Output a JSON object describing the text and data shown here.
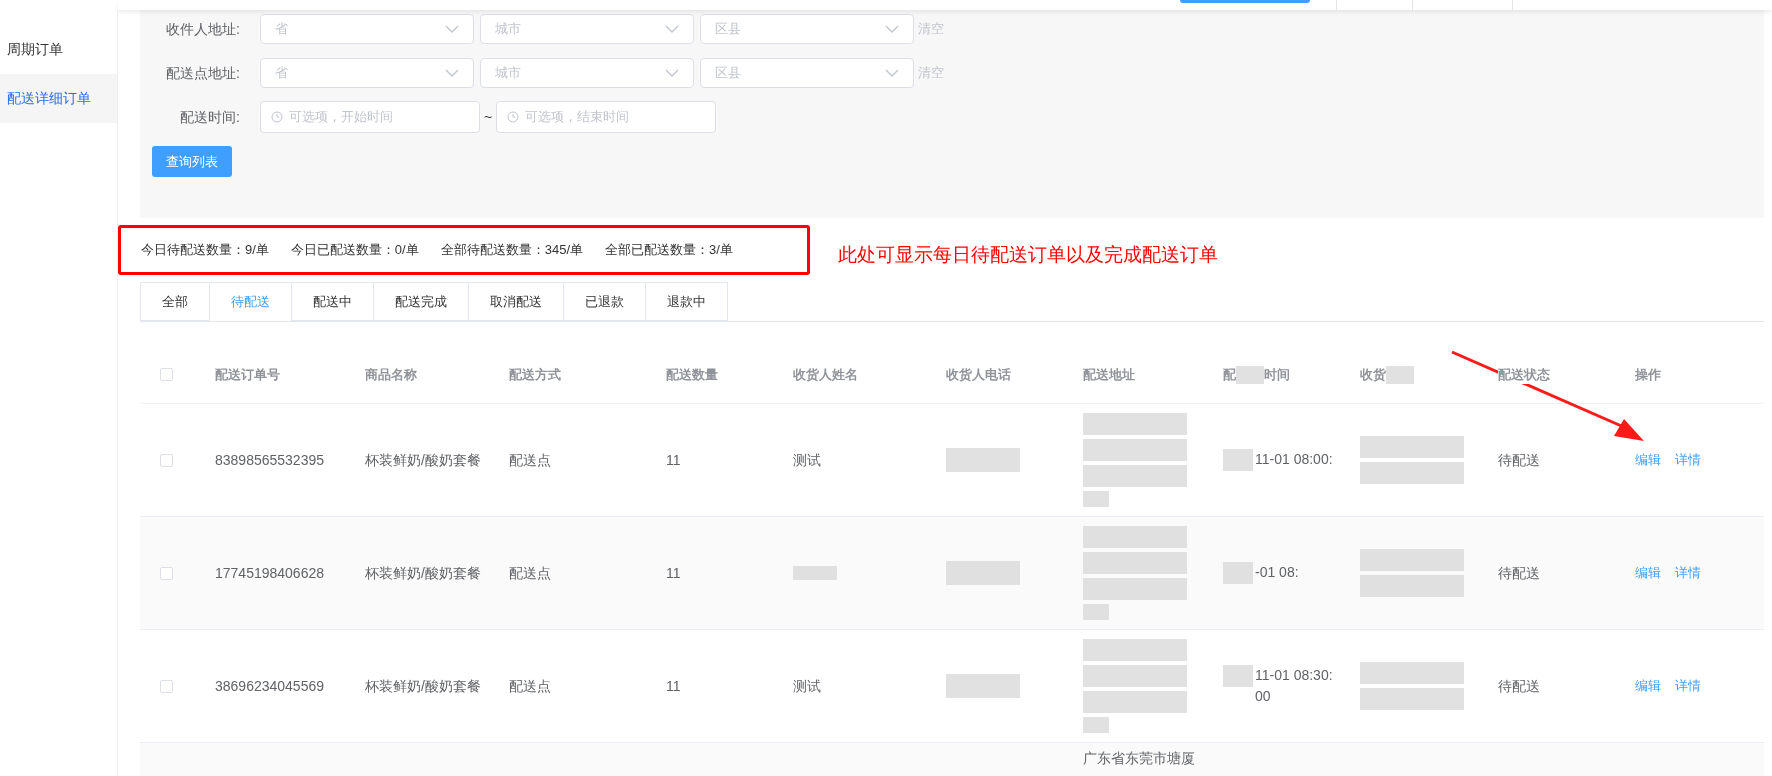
{
  "sidebar": {
    "items": [
      {
        "label": "周期订单",
        "selected": false
      },
      {
        "label": "配送详细订单",
        "selected": true
      }
    ]
  },
  "filters": {
    "address_rows": [
      {
        "label": "收件人地址:",
        "selects": [
          {
            "placeholder": "省"
          },
          {
            "placeholder": "城市"
          },
          {
            "placeholder": "区县"
          }
        ],
        "clear": "清空"
      },
      {
        "label": "配送点地址:",
        "selects": [
          {
            "placeholder": "省"
          },
          {
            "placeholder": "城市"
          },
          {
            "placeholder": "区县"
          }
        ],
        "clear": "清空"
      }
    ],
    "time": {
      "label": "配送时间:",
      "start": {
        "placeholder": "可选项，开始时间"
      },
      "separator": "~",
      "end": {
        "placeholder": "可选项，结束时间"
      }
    },
    "query_button": "查询列表"
  },
  "stats": [
    "今日待配送数量：9/单",
    "今日已配送数量：0/单",
    "全部待配送数量：345/单",
    "全部已配送数量：3/单"
  ],
  "annotation": {
    "note": "此处可显示每日待配送订单以及完成配送订单"
  },
  "tabs": [
    {
      "label": "全部",
      "selected": false
    },
    {
      "label": "待配送",
      "selected": true
    },
    {
      "label": "配送中",
      "selected": false
    },
    {
      "label": "配送完成",
      "selected": false
    },
    {
      "label": "取消配送",
      "selected": false
    },
    {
      "label": "已退款",
      "selected": false
    },
    {
      "label": "退款中",
      "selected": false
    }
  ],
  "table": {
    "select_all": {
      "checked": false
    },
    "columns": [
      {
        "text": "配送订单号"
      },
      {
        "text": "商品名称"
      },
      {
        "text": "配送方式"
      },
      {
        "text": "配送数量"
      },
      {
        "text": "收货人姓名"
      },
      {
        "text": "收货人电话"
      },
      {
        "text": "配送地址"
      },
      {
        "text": "配",
        "tail": "时间",
        "redacted": true
      },
      {
        "text": "收货",
        "redacted": true
      },
      {
        "text": "配送状态"
      },
      {
        "text": "操作"
      }
    ],
    "rows": [
      {
        "checked": false,
        "order_no": "83898565532395",
        "product": "杯装鲜奶/酸奶套餐",
        "method": "配送点",
        "qty": "11",
        "name": {
          "text": "测试",
          "redacted": false
        },
        "time": [
          "11-01 08:00:"
        ],
        "status": "待配送",
        "actions": [
          "编辑",
          "详情"
        ]
      },
      {
        "checked": false,
        "order_no": "17745198406628",
        "product": "杯装鲜奶/酸奶套餐",
        "method": "配送点",
        "qty": "11",
        "name": {
          "redacted": true
        },
        "time": [
          "-01 08:"
        ],
        "status": "待配送",
        "actions": [
          "编辑",
          "详情"
        ]
      },
      {
        "checked": false,
        "order_no": "38696234045569",
        "product": "杯装鲜奶/酸奶套餐",
        "method": "配送点",
        "qty": "11",
        "name": {
          "text": "测试",
          "redacted": false
        },
        "time": [
          "11-01 08:30:",
          "00"
        ],
        "status": "待配送",
        "actions": [
          "编辑",
          "详情"
        ]
      }
    ],
    "partial_row": {
      "address": "广东省东莞市塘厦"
    }
  }
}
